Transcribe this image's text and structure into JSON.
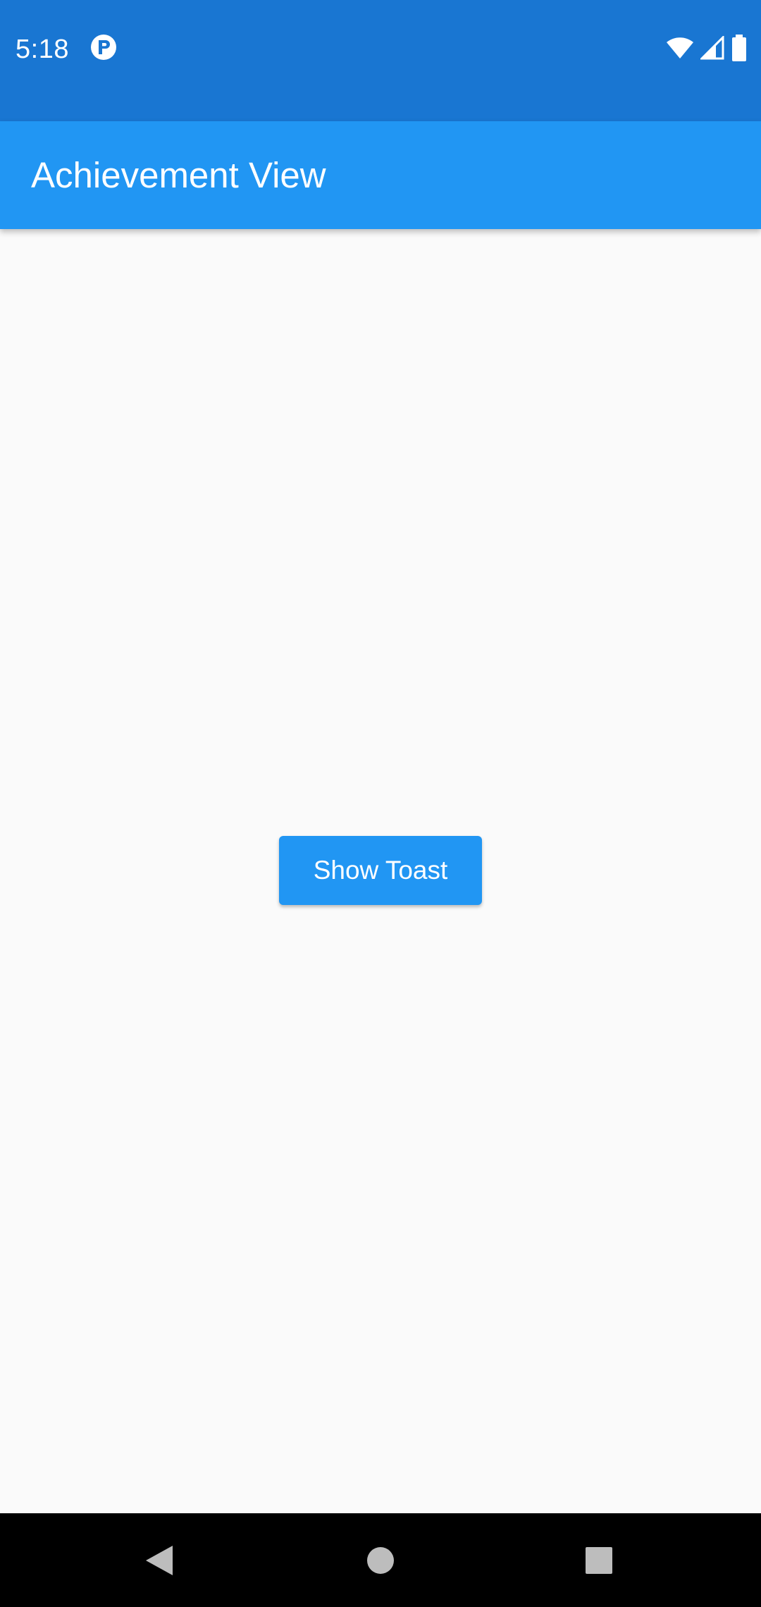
{
  "status_bar": {
    "time": "5:18",
    "app_icon": "p-badge-icon",
    "icons": [
      "wifi-icon",
      "signal-icon",
      "battery-icon"
    ],
    "color": "#1976D2"
  },
  "app_bar": {
    "title": "Achievement View",
    "color": "#2196F3"
  },
  "main": {
    "button_label": "Show Toast",
    "background": "#fafafa"
  },
  "nav_bar": {
    "buttons": [
      "back-icon",
      "home-icon",
      "recents-icon"
    ]
  }
}
